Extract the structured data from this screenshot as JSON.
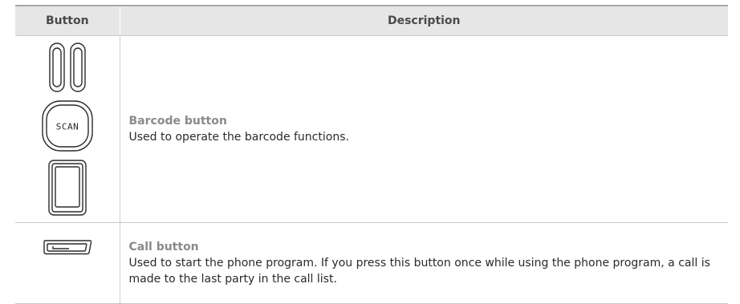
{
  "table": {
    "headers": {
      "button": "Button",
      "description": "Description"
    },
    "rows": [
      {
        "icons": [
          "side-buttons-icon",
          "scan-button-icon",
          "square-button-icon"
        ],
        "title": "Barcode button",
        "text": "Used to operate the barcode functions.",
        "scan_label": "SCAN"
      },
      {
        "icons": [
          "call-button-icon"
        ],
        "title": "Call button",
        "text": "Used to start the phone program. If you press this button once while using the phone program, a call is made to the last party in the call list."
      }
    ]
  },
  "colors": {
    "header_bg": "#e6e6e6",
    "title_text": "#8a8a8a",
    "body_text": "#2a2a2a",
    "icon_stroke": "#2a2a2a"
  }
}
